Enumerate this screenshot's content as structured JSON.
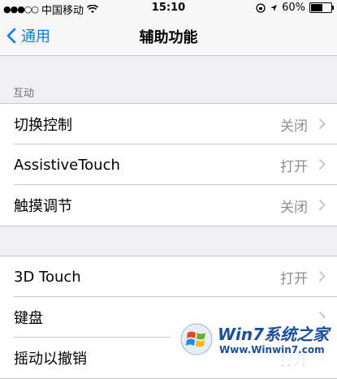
{
  "status_bar": {
    "signal_dots": "●●●○○",
    "carrier": "中国移动",
    "time": "15:10",
    "battery_percent": "60%",
    "battery_level": 0.6
  },
  "nav": {
    "back_label": "通用",
    "title": "辅助功能"
  },
  "section_interaction": {
    "header": "互动",
    "rows": [
      {
        "label": "切换控制",
        "value": "关闭"
      },
      {
        "label": "AssistiveTouch",
        "value": "打开"
      },
      {
        "label": "触摸调节",
        "value": "关闭"
      }
    ]
  },
  "section_second": {
    "rows": [
      {
        "label": "3D Touch",
        "value": "打开"
      },
      {
        "label": "键盘",
        "value": ""
      },
      {
        "label": "摇动以撤销",
        "value": "打开"
      }
    ]
  },
  "watermark": {
    "brand": "Win7系统之家",
    "url": "Www.Winwin7.com"
  },
  "colors": {
    "accent": "#007aff",
    "background": "#efeff4",
    "secondary_text": "#8e8e93"
  }
}
